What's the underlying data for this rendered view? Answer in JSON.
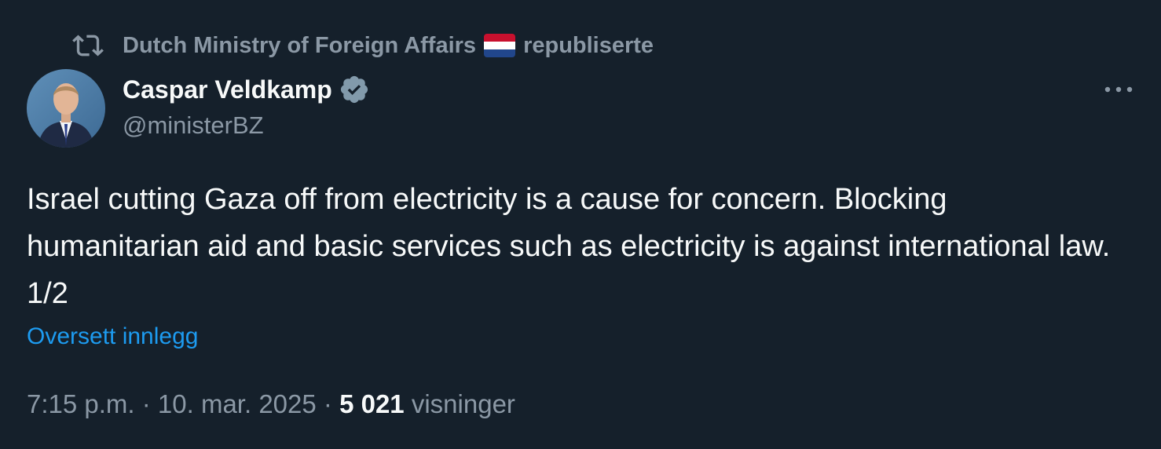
{
  "repost": {
    "account": "Dutch Ministry of Foreign Affairs",
    "flag_icon": "netherlands-flag-icon",
    "action": "republiserte",
    "icon": "repost-icon"
  },
  "author": {
    "display_name": "Caspar Veldkamp",
    "handle": "@ministerBZ",
    "verified_icon": "verified-badge-icon",
    "avatar": "avatar"
  },
  "tweet": {
    "text": "Israel cutting Gaza off from electricity is a cause for concern. Blocking humanitarian aid and basic services such as electricity is against international law. 1/2",
    "translate_label": "Oversett innlegg"
  },
  "meta": {
    "time": "7:15 p.m.",
    "separator": "·",
    "date": "10. mar. 2025",
    "views_count": "5 021",
    "views_label": "visninger"
  },
  "more_icon": "more-options-icon",
  "colors": {
    "background": "#15202b",
    "primary_text": "#f7f9f9",
    "secondary_text": "#8b98a5",
    "link": "#1d9bf0",
    "verified_badge": "#829aab"
  }
}
